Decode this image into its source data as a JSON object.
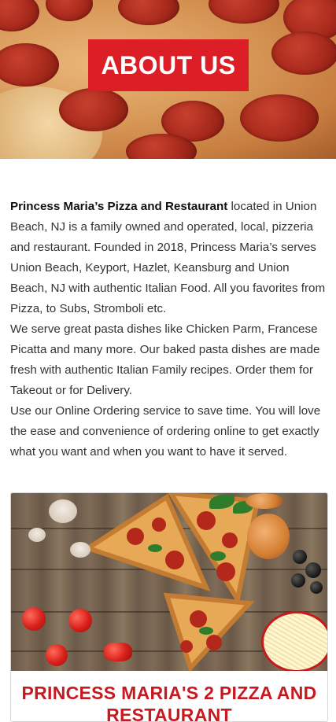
{
  "hero": {
    "title": "ABOUT US"
  },
  "about": {
    "business_name": "Princess Maria’s Pizza and Restaurant",
    "paragraph_1_rest": " located in Union Beach, NJ is a family owned and operated, local, pizzeria and restaurant.  Founded in 2018, Princess Maria’s serves Union Beach, Keyport, Hazlet, Keansburg and Union Beach, NJ with authentic Italian Food.  All you favorites from Pizza, to Subs, Stromboli etc.",
    "paragraph_2": "We serve great pasta dishes like Chicken Parm, Francese Picatta and many more.  Our baked pasta dishes are made fresh with authentic Italian Family recipes.  Order them for Takeout or for Delivery.",
    "paragraph_3": "Use our Online Ordering service to save time.  You will love the ease and convenience of ordering online to get exactly what you want and when you want to have it served."
  },
  "card": {
    "title": "PRINCESS MARIA'S 2 PIZZA AND RESTAURANT"
  },
  "colors": {
    "accent_red": "#dc1f26",
    "card_title_red": "#c61a21"
  }
}
